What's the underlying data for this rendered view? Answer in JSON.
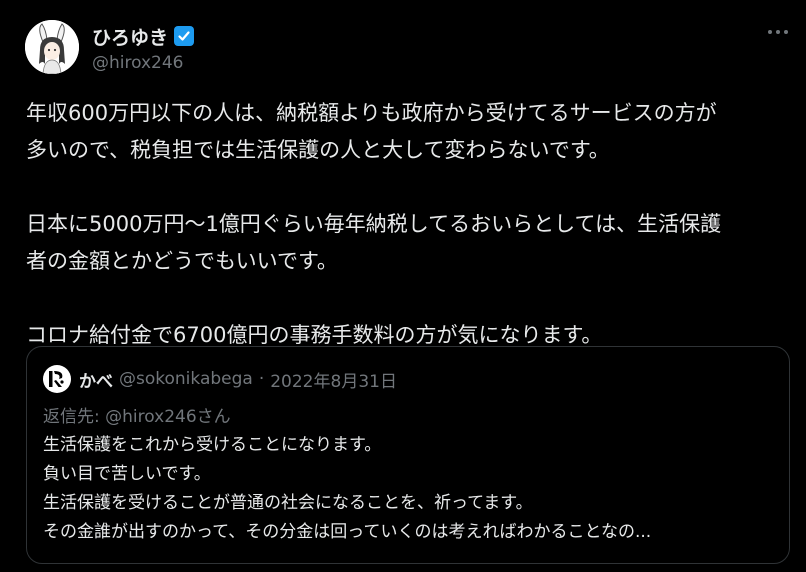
{
  "author": {
    "display_name": "ひろゆき",
    "handle": "@hirox246",
    "verified": true
  },
  "tweet": {
    "paragraphs": [
      [
        "年収600万円以下の人は、納税額よりも政府から受けてるサービスの方が",
        "多いので、税負担では生活保護の人と大して変わらないです。"
      ],
      [
        "日本に5000万円〜1億円ぐらい毎年納税してるおいらとしては、生活保護",
        "者の金額とかどうでもいいです。"
      ],
      [
        "コロナ給付金で6700億円の事務手数料の方が気になります。"
      ]
    ]
  },
  "quote": {
    "display_name": "かべ",
    "handle": "@sokonikabega",
    "separator": "·",
    "date": "2022年8月31日",
    "reply_prefix": "返信先:",
    "reply_target": "@hirox246さん",
    "lines": [
      "生活保護をこれから受けることになります。",
      "負い目で苦しいです。",
      "生活保護を受けることが普通の社会になることを、祈ってます。",
      "その金誰が出すのかって、その分金は回っていくのは考えればわかることなの..."
    ]
  },
  "icons": {
    "verified": "verified-badge-icon",
    "more": "more-options-icon"
  },
  "colors": {
    "background": "#000000",
    "text_primary": "#e7e9ea",
    "text_secondary": "#71767b",
    "verified_blue": "#1d9bf0",
    "border": "#2f3336"
  }
}
